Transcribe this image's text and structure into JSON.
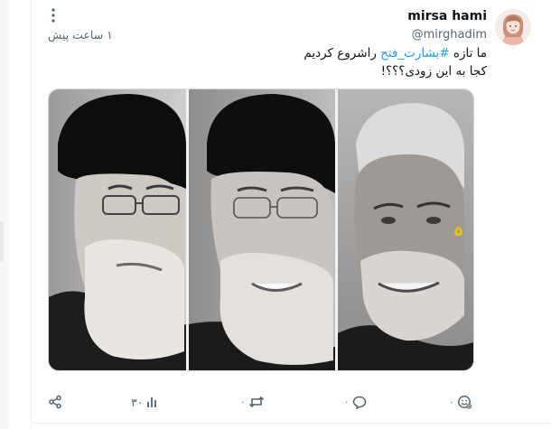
{
  "post": {
    "display_name": "mirsa hami",
    "handle": "@mirghadim",
    "timestamp": "۱ ساعت پیش",
    "text_before_hashtag": "ما تازه ",
    "hashtag": "#بشارت_فتح",
    "text_after_hashtag": " راشروع کردیم",
    "text_line2": "کجا به این زودی؟؟؟!",
    "media_badge": "۵"
  },
  "actions": {
    "views_count": "۳۰",
    "retweet_count": "۰",
    "reply_count": "۰",
    "like_count": "۰"
  },
  "icons": {
    "more": "more-vertical-icon",
    "share": "share-icon",
    "views": "views-bar-icon",
    "retweet": "retweet-icon",
    "reply": "reply-icon",
    "like": "like-emoji-icon"
  },
  "colors": {
    "link": "#1d9bf0",
    "muted": "#536471",
    "badge": "#f2c500"
  }
}
